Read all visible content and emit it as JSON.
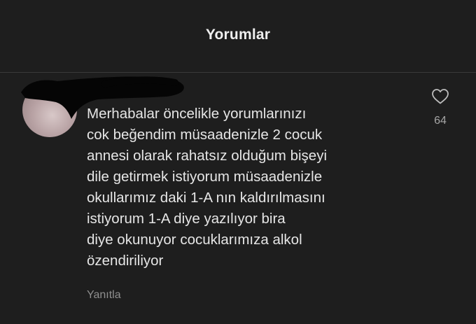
{
  "header": {
    "title": "Yorumlar"
  },
  "comment": {
    "text": "Merhabalar öncelikle yorumlarınızı\ncok beğendim müsaadenizle 2 cocuk\nannesi olarak rahatsız olduğum bişeyi\ndile getirmek istiyorum müsaadenizle\nokullarımız daki 1-A nın kaldırılmasını\nistiyorum 1-A diye yazılıyor bira\ndiye okunuyor cocuklarımıza alkol\nözendiriliyor",
    "reply_label": "Yanıtla",
    "like_count": "64"
  },
  "icons": {
    "like": "heart-outline-icon"
  },
  "colors": {
    "background": "#1e1e1e",
    "text": "#e6e6e6",
    "muted": "#8f8f8f"
  }
}
